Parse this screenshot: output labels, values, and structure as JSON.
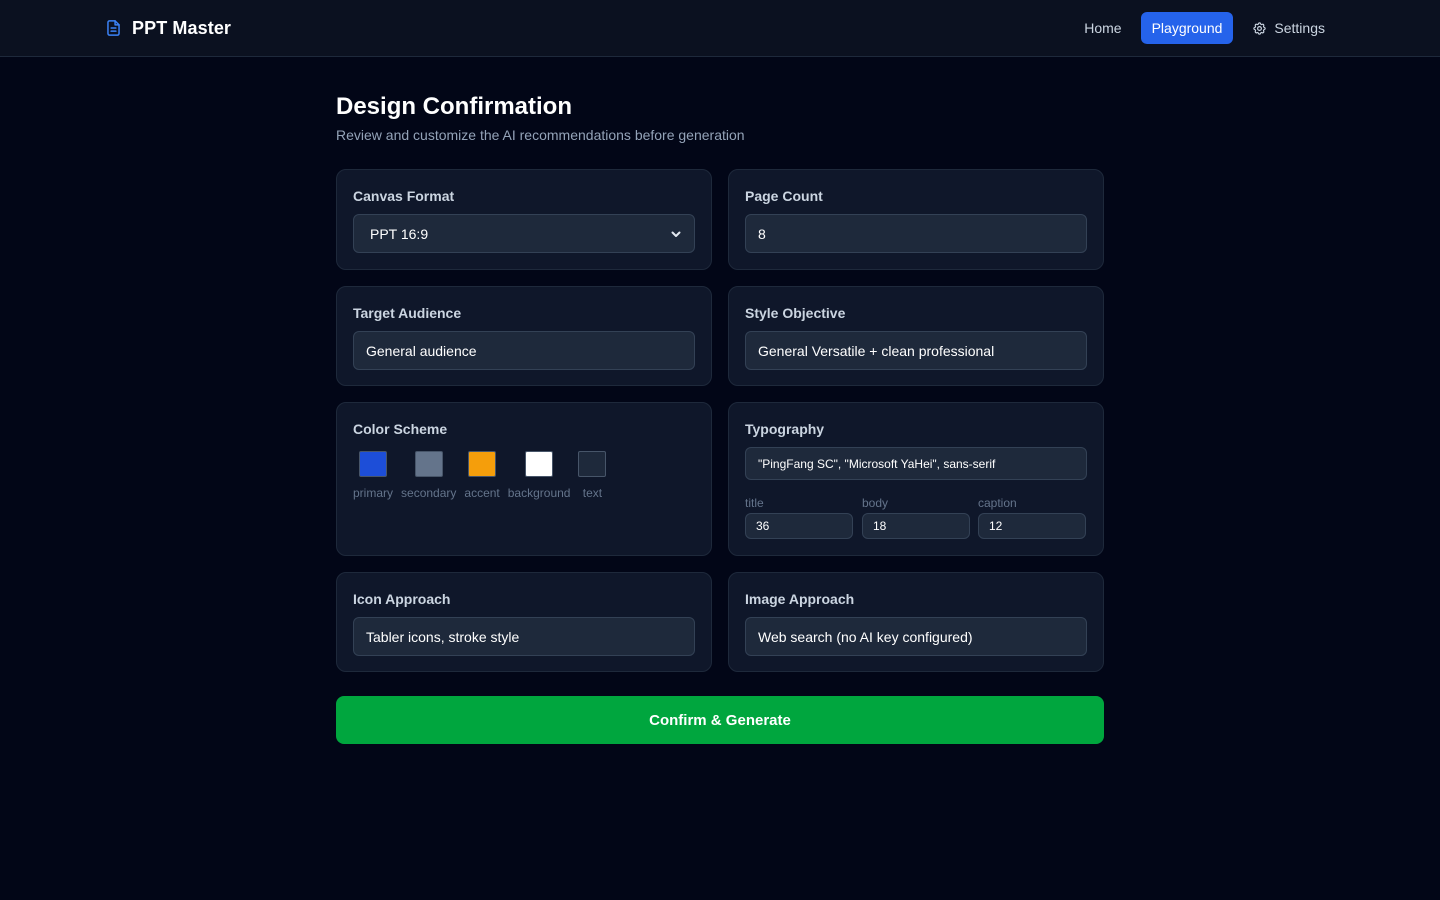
{
  "app": {
    "name": "PPT Master",
    "brand_icon": "file-text-icon"
  },
  "nav": {
    "home": "Home",
    "playground": "Playground",
    "settings": "Settings",
    "active": "playground"
  },
  "page": {
    "title": "Design Confirmation",
    "subtitle": "Review and customize the AI recommendations before generation"
  },
  "canvas_format": {
    "label": "Canvas Format",
    "value": "PPT 16:9"
  },
  "page_count": {
    "label": "Page Count",
    "value": "8"
  },
  "target_audience": {
    "label": "Target Audience",
    "value": "General audience"
  },
  "style_objective": {
    "label": "Style Objective",
    "value": "General Versatile + clean professional"
  },
  "color_scheme": {
    "label": "Color Scheme",
    "swatches": [
      {
        "name": "primary",
        "color": "#1d4ed8"
      },
      {
        "name": "secondary",
        "color": "#64748b"
      },
      {
        "name": "accent",
        "color": "#f59e0b"
      },
      {
        "name": "background",
        "color": "#ffffff"
      },
      {
        "name": "text",
        "color": "#1e293b"
      }
    ]
  },
  "typography": {
    "label": "Typography",
    "font_family": "\"PingFang SC\", \"Microsoft YaHei\", sans-serif",
    "sizes": {
      "title_label": "title",
      "title_value": "36",
      "body_label": "body",
      "body_value": "18",
      "caption_label": "caption",
      "caption_value": "12"
    }
  },
  "icon_approach": {
    "label": "Icon Approach",
    "value": "Tabler icons, stroke style"
  },
  "image_approach": {
    "label": "Image Approach",
    "value": "Web search (no AI key configured)"
  },
  "actions": {
    "confirm_label": "Confirm & Generate",
    "confirm_color": "#00a63e"
  },
  "colors": {
    "accent": "#2563eb",
    "background": "#020617",
    "card": "#0f172a"
  }
}
